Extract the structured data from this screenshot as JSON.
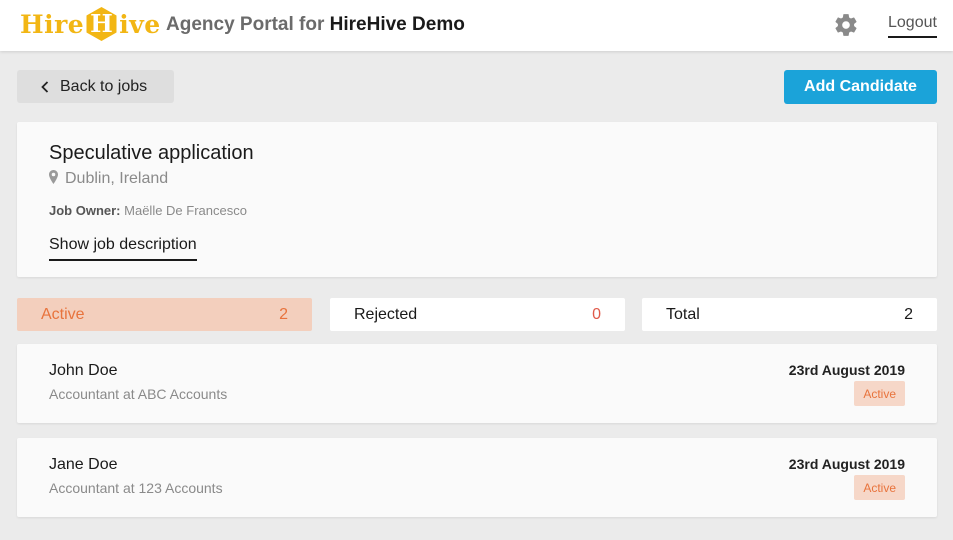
{
  "header": {
    "logo_left": "Hire",
    "logo_h": "H",
    "logo_right": "ive",
    "portal_prefix": "Agency Portal for",
    "company": "HireHive Demo",
    "settings_icon": "gear-icon",
    "logout_label": "Logout"
  },
  "toolbar": {
    "back_label": "Back to jobs",
    "back_icon": "chevron-left-icon",
    "add_label": "Add Candidate"
  },
  "job": {
    "title": "Speculative application",
    "location": "Dublin, Ireland",
    "location_icon": "map-pin-icon",
    "owner_label": "Job Owner:",
    "owner_name": "Maëlle De Francesco",
    "show_description": "Show job description"
  },
  "tabs": [
    {
      "label": "Active",
      "count": "2"
    },
    {
      "label": "Rejected",
      "count": "0"
    },
    {
      "label": "Total",
      "count": "2"
    }
  ],
  "candidates": [
    {
      "name": "John Doe",
      "role": "Accountant at ABC Accounts",
      "date": "23rd August 2019",
      "status": "Active"
    },
    {
      "name": "Jane Doe",
      "role": "Accountant at 123 Accounts",
      "date": "23rd August 2019",
      "status": "Active"
    }
  ],
  "colors": {
    "brand_yellow": "#f2b614",
    "primary_button": "#1ba3d9",
    "active_tab_bg": "#f3cfbd",
    "active_accent": "#e8733c",
    "rejected_count": "#e05a4a",
    "page_bg": "#ebebeb"
  }
}
